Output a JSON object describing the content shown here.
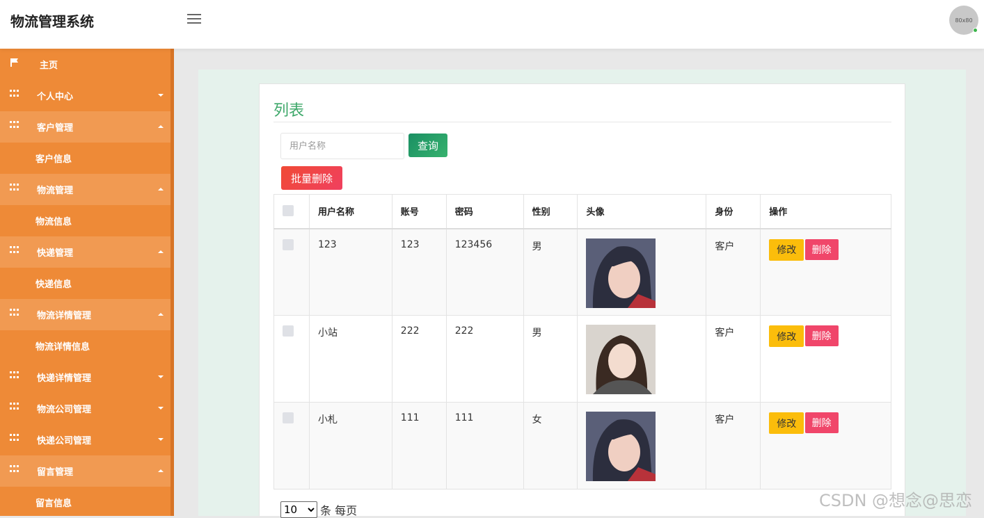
{
  "header": {
    "app_title": "物流管理系统",
    "avatar_text": "80x80"
  },
  "sidebar": {
    "items": [
      {
        "label": "主页",
        "icon": "flag-icon",
        "state": "none"
      },
      {
        "label": "个人中心",
        "icon": "grid-icon",
        "state": "collapsed"
      },
      {
        "label": "客户管理",
        "icon": "grid-icon",
        "state": "expanded",
        "children": [
          "客户信息"
        ]
      },
      {
        "label": "物流管理",
        "icon": "grid-icon",
        "state": "expanded",
        "children": [
          "物流信息"
        ]
      },
      {
        "label": "快递管理",
        "icon": "grid-icon",
        "state": "expanded",
        "children": [
          "快递信息"
        ]
      },
      {
        "label": "物流详情管理",
        "icon": "grid-icon",
        "state": "expanded",
        "children": [
          "物流详情信息"
        ]
      },
      {
        "label": "快递详情管理",
        "icon": "grid-icon",
        "state": "collapsed"
      },
      {
        "label": "物流公司管理",
        "icon": "grid-icon",
        "state": "collapsed"
      },
      {
        "label": "快递公司管理",
        "icon": "grid-icon",
        "state": "collapsed"
      },
      {
        "label": "留言管理",
        "icon": "grid-icon",
        "state": "expanded",
        "children": [
          "留言信息"
        ]
      }
    ]
  },
  "main": {
    "title": "列表",
    "search": {
      "placeholder": "用户名称",
      "value": ""
    },
    "search_button": "查询",
    "batch_delete_button": "批量删除",
    "table": {
      "columns": [
        "用户名称",
        "账号",
        "密码",
        "性别",
        "头像",
        "身份",
        "操作"
      ],
      "rows": [
        {
          "name": "123",
          "account": "123",
          "password": "123456",
          "gender": "男",
          "identity": "客户"
        },
        {
          "name": "小站",
          "account": "222",
          "password": "222",
          "gender": "男",
          "identity": "客户"
        },
        {
          "name": "小札",
          "account": "111",
          "password": "111",
          "gender": "女",
          "identity": "客户"
        }
      ],
      "edit_label": "修改",
      "delete_label": "删除"
    },
    "pagination": {
      "page_size": "10",
      "per_page_text": "条 每页"
    }
  },
  "watermark": "CSDN @想念@思恋",
  "colors": {
    "sidebar_bg": "#ee8a37",
    "accent_green": "#3ea86a",
    "edit_yellow": "#fbbd0b",
    "delete_red": "#f0466a"
  }
}
